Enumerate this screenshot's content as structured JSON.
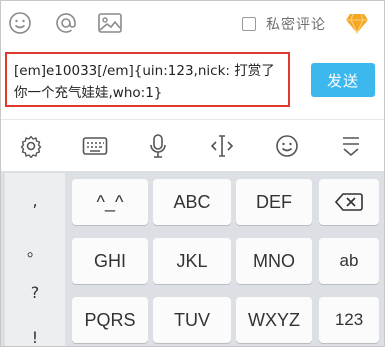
{
  "topbar": {
    "icons": [
      "smiley-icon",
      "at-icon",
      "image-icon",
      "gem-icon"
    ],
    "private_comment_label": "私密评论",
    "private_checked": false
  },
  "input": {
    "text": "[em]e10033[/em]{uin:123,nick: 打赏了你一个充气娃娃,who:1}"
  },
  "send_label": "发送",
  "keyboard_toolbar": {
    "icons": [
      "settings-icon",
      "keyboard-icon",
      "microphone-icon",
      "cursor-move-icon",
      "emoji-icon",
      "hide-keyboard-icon"
    ]
  },
  "keyboard": {
    "punctuation": [
      ",",
      "。",
      "?",
      "!"
    ],
    "row1": [
      "^_^",
      "ABC",
      "DEF"
    ],
    "row2": [
      "GHI",
      "JKL",
      "MNO"
    ],
    "row3": [
      "PQRS",
      "TUV",
      "WXYZ"
    ],
    "side": {
      "backspace_icon": "backspace-icon",
      "ab": "ab",
      "num": "123"
    }
  },
  "colors": {
    "accent": "#3db8ee",
    "highlight_border": "#e0392d",
    "gem": "#f5a623",
    "keyboard_bg": "#dcdfe3"
  }
}
